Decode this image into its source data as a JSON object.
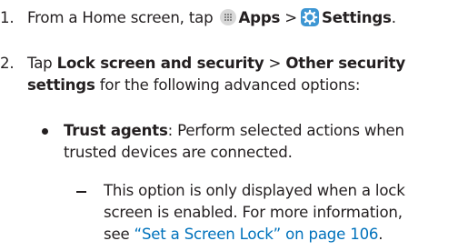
{
  "step1": {
    "num": "1.",
    "text_prefix": "From a Home screen, tap",
    "apps_label": "Apps",
    "sep": ">",
    "settings_label": "Settings",
    "period": "."
  },
  "step2": {
    "num": "2.",
    "tap": "Tap",
    "lock_label": "Lock screen and security",
    "sep": ">",
    "other_label_1": "Other security",
    "other_label_2": "settings",
    "rest": "for the following advanced options:"
  },
  "bullet1": {
    "title": "Trust agents",
    "text_1": ": Perform selected actions when",
    "text_2": "trusted devices are connected."
  },
  "sub1": {
    "line1": "This option is only displayed when a lock",
    "line2": "screen is enabled. For more information,",
    "line3_prefix": "see",
    "link_text": "“Set a Screen Lock” on page 106",
    "line3_suffix": "."
  }
}
